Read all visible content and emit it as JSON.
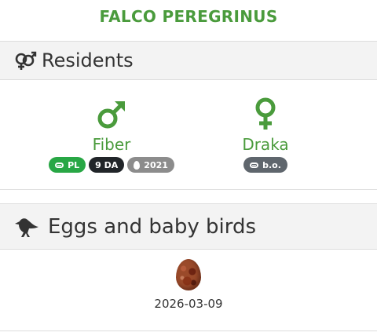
{
  "page": {
    "title": "FALCO PEREGRINUS"
  },
  "residents": {
    "heading": "Residents",
    "heading_icon": "gender-symbols-icon",
    "birds": [
      {
        "sex": "male",
        "icon": "male-symbol-icon",
        "name": "Fiber",
        "badges": [
          {
            "icon": "ring-icon",
            "label": "PL",
            "color": "#28a745"
          },
          {
            "label": "9 DA",
            "color": "#212529"
          },
          {
            "icon": "egg-icon",
            "label": "2021",
            "color": "#8c8c8c"
          }
        ]
      },
      {
        "sex": "female",
        "icon": "female-symbol-icon",
        "name": "Draka",
        "badges": [
          {
            "icon": "ring-icon",
            "label": "b.o.",
            "color": "#5f666d"
          }
        ]
      }
    ]
  },
  "eggs": {
    "heading": "Eggs and baby birds",
    "heading_icon": "crow-icon",
    "items": [
      {
        "icon": "egg-photo",
        "date": "2026-03-09"
      }
    ]
  },
  "colors": {
    "accent_green": "#4a9b3c",
    "header_bg": "#f3f3f3"
  }
}
